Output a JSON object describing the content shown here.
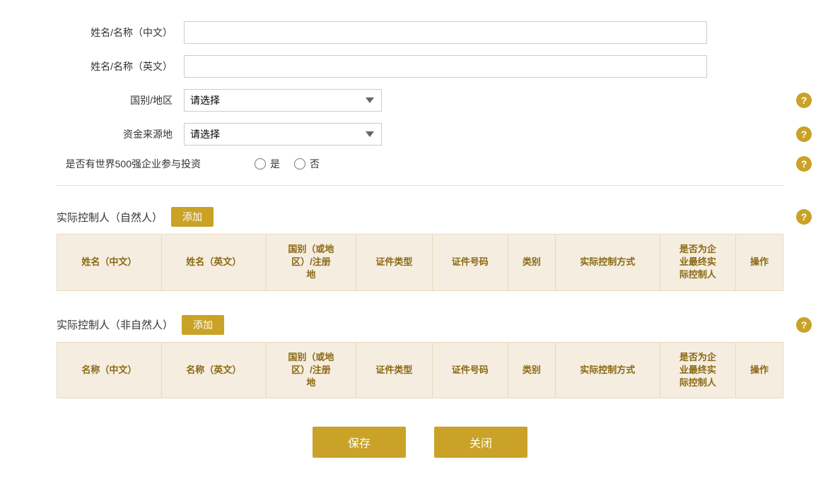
{
  "form": {
    "name_zh_label": "姓名/名称（中文）",
    "name_en_label": "姓名/名称（英文）",
    "country_label": "国别/地区",
    "fund_source_label": "资金来源地",
    "fortune500_label": "是否有世界500强企业参与投资",
    "radio_yes": "是",
    "radio_no": "否",
    "country_placeholder": "请选择",
    "fund_placeholder": "请选择",
    "name_zh_value": "",
    "name_en_value": ""
  },
  "natural_section": {
    "title": "实际控制人（自然人）",
    "add_label": "添加",
    "columns": [
      "姓名（中文）",
      "姓名（英文）",
      "国别（或地区）/注册地",
      "证件类型",
      "证件号码",
      "类别",
      "实际控制方式",
      "是否为企业最终实际控制人",
      "操作"
    ]
  },
  "non_natural_section": {
    "title": "实际控制人（非自然人）",
    "add_label": "添加",
    "columns": [
      "名称（中文）",
      "名称（英文）",
      "国别（或地区）/注册地",
      "证件类型",
      "证件号码",
      "类别",
      "实际控制方式",
      "是否为企业最终实际控制人",
      "操作"
    ]
  },
  "buttons": {
    "save": "保存",
    "close": "关闭"
  },
  "help_icon": "?",
  "colors": {
    "gold": "#c9a227",
    "table_header_bg": "#f5ede0",
    "table_header_text": "#8b6914"
  }
}
